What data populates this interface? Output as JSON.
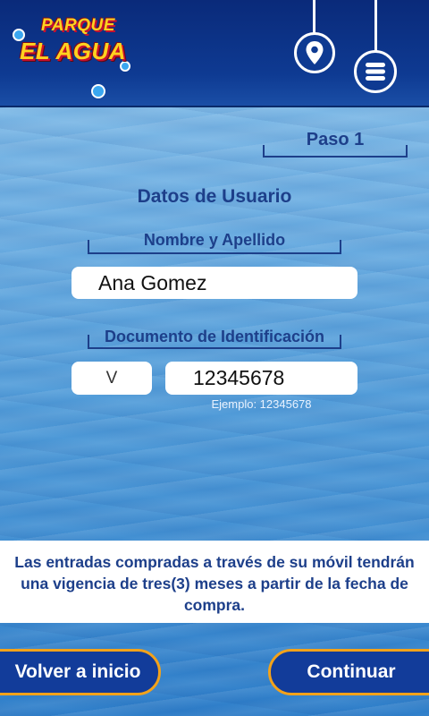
{
  "header": {
    "logo_top": "PARQUE",
    "logo_main": "EL AGUA",
    "location_icon": "location-pin-icon",
    "menu_icon": "menu-stack-icon"
  },
  "step": {
    "label": "Paso 1"
  },
  "form": {
    "title": "Datos de Usuario",
    "name": {
      "label": "Nombre y Apellido",
      "value": "Ana Gomez"
    },
    "document": {
      "label": "Documento de Identificación",
      "type_value": "V",
      "number_value": "12345678",
      "hint": "Ejemplo: 12345678"
    }
  },
  "notice": {
    "text": "Las entradas compradas a través de su móvil tendrán una vigencia de tres(3) meses a partir de la fecha de compra."
  },
  "footer": {
    "back_label": "Volver a inicio",
    "continue_label": "Continuar"
  },
  "colors": {
    "header": "#0e3a92",
    "text_blue": "#1d3f8a",
    "button_border": "#f3a21a",
    "button_fill": "#123c9a"
  }
}
